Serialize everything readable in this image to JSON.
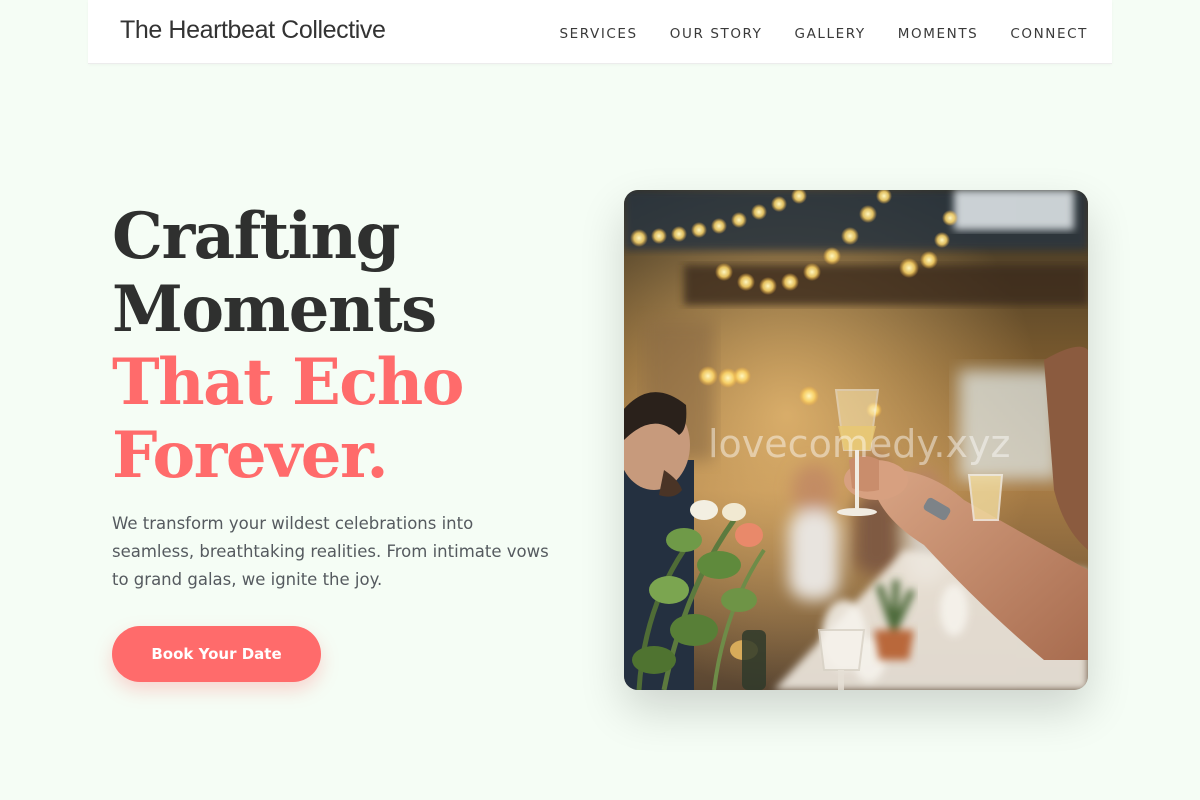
{
  "header": {
    "brand": "The Heartbeat Collective",
    "nav": [
      {
        "label": "SERVICES"
      },
      {
        "label": "OUR STORY"
      },
      {
        "label": "GALLERY"
      },
      {
        "label": "MOMENTS"
      },
      {
        "label": "CONNECT"
      }
    ]
  },
  "hero": {
    "heading_lines": [
      "Crafting",
      "Moments",
      "That Echo",
      "Forever."
    ],
    "subtitle": "We transform your wildest celebrations into seamless, breathtaking realities. From intimate vows to grand galas, we ignite the joy.",
    "cta_label": "Book Your Date",
    "image_watermark": "lovecomedy.xyz"
  },
  "colors": {
    "background": "#f5fdf5",
    "accent": "#ff6b6b",
    "heading": "#2f302f",
    "body_text": "#555a5f"
  }
}
